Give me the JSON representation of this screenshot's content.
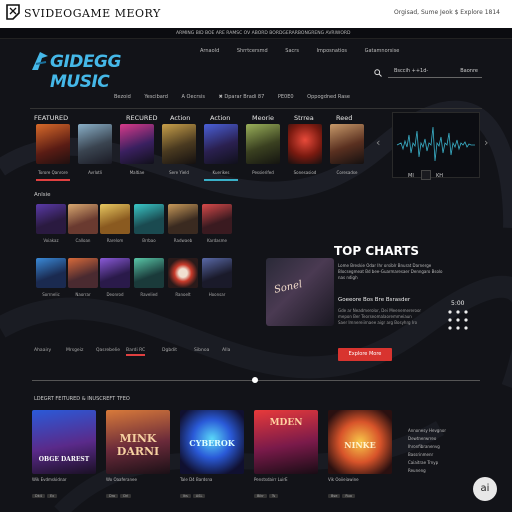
{
  "header": {
    "title": "SVIDEOGAME MEORY",
    "meta": "Orgisad, Sume Jeok  $  Explore  1814"
  },
  "ticker": "ARMING BID BOE ARE RAMSC OV ABORD BORDGERARBONGRENG AVRIWORD",
  "logo": {
    "text": "GIDEGG MUSIC"
  },
  "nav": [
    "Arnaold",
    "Shrrtcersmd",
    "Sacrs",
    "Imposnatios",
    "Gatamnorsise"
  ],
  "search": {
    "placeholder": "Bsccih ++1d-",
    "button": "Baonre"
  },
  "genres": [
    "Bezoid",
    "Yescibard",
    "A Oecrsis",
    "✖ Dparar Bradi 87",
    "PE0E0",
    "Oppogdned Rase"
  ],
  "featured": {
    "labels": [
      "FEATURED",
      "RECURED",
      "Action",
      "Action",
      "Meorie",
      "Strrea",
      "Reed"
    ],
    "captions": [
      "Torore Qanrore",
      "Avrlotli",
      "Maltiae",
      "Sere Yield",
      "Kuerikes",
      "Pessierifed",
      "Sonesasiod",
      "Coresadse"
    ],
    "controls": {
      "prev": "MI",
      "next": "KH"
    }
  },
  "grid": {
    "title": "Anlsie",
    "captions": [
      "Voiakaz",
      "Calloan",
      "Rarelom",
      "Brrbao",
      "Radwaeb",
      "Kardasme",
      "Sorrnelic",
      "Naorrar",
      "Deonrod",
      "Ravelied",
      "Ranoelt",
      "Hoonsar"
    ]
  },
  "tabs": [
    "Ahaairy",
    "Mrsgeiz",
    "Qasrebelie",
    "Bardi RC",
    "Dgbdit",
    "Sibnoa",
    "Alla"
  ],
  "top_charts": {
    "title": "TOP CHARTS",
    "blurb": "Lome Breskie Odar Ihr orsiblr Bnurat Darnerge Blocsegmeat Bd bee-Guarmaresaer Denngaro Bsolo nas ndigh",
    "cover_text": "Sonel",
    "subtitle": "Goeeore Bos Bre Bsrasder",
    "desc": "Gde ar Neadmerolor, Dei Meenemereroor mepon Ber Teorseomalaoremmeiaun Saer Imnereiirnaee aigr arg Bosyhrg Iro",
    "time": "5:00",
    "button": "Explore More"
  },
  "latest": {
    "title": "LDEGRT FEITURED & INUSCREFT TFEO",
    "albums": [
      {
        "art": "OBGE DAREST",
        "caption": "Wik Evdmskidnar",
        "btns": [
          "Dk4",
          "Ex"
        ]
      },
      {
        "art": "MINK DARNI",
        "caption": "Wo Oaaferanee",
        "btns": [
          "Dro",
          "Drl"
        ]
      },
      {
        "art": "CYBEROK",
        "caption": "Tale D4 Bardsna",
        "btns": [
          "Iks",
          "ASL"
        ]
      },
      {
        "art": "MDEN",
        "caption": "Penstsdairr LuirE",
        "btns": [
          "Bikr",
          "Ts"
        ]
      },
      {
        "art": "NINKE",
        "caption": "Vik Ooiieiawine",
        "btns": [
          "Bse",
          "Ruo"
        ]
      }
    ],
    "side_list": [
      "Annonesy Hevgnor",
      "Dewtnerwrreo",
      "Ihronfibranenvg",
      "Bassrinmenr",
      "Caiaitrae Trnyp",
      "Reuneng"
    ]
  },
  "badge": "ai",
  "colors": {
    "accent": "#45b8e8",
    "button": "#d8342f",
    "bg": "#121318"
  }
}
